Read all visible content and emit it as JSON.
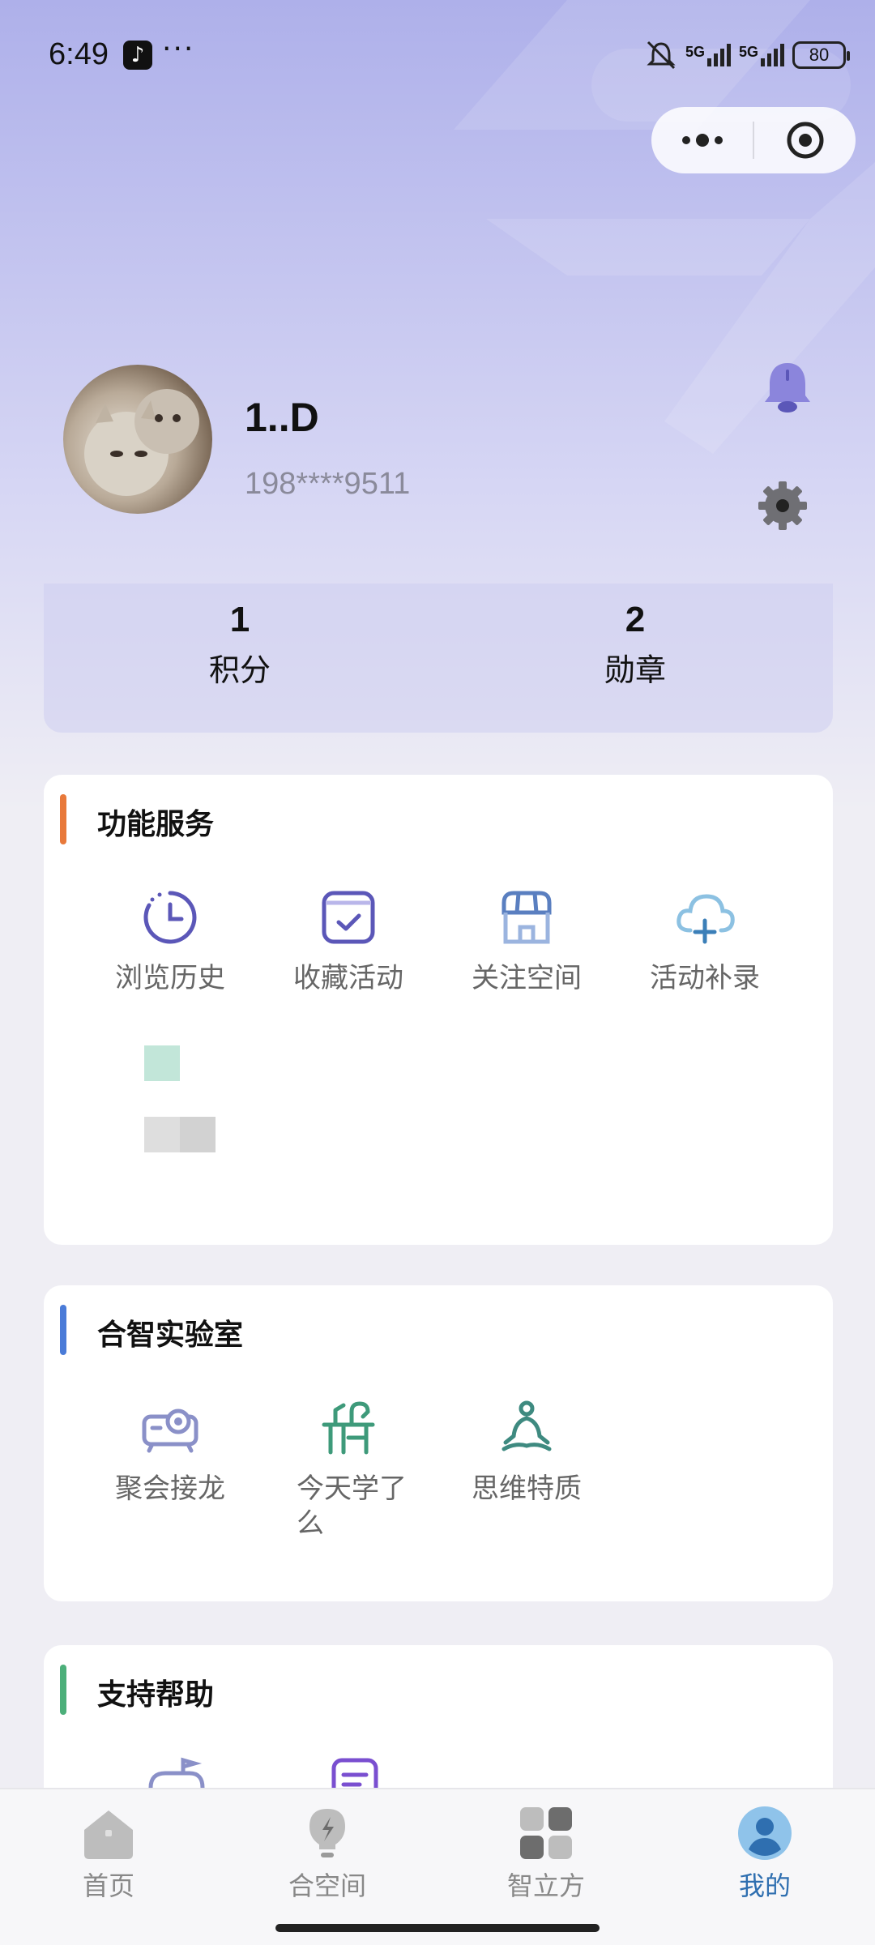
{
  "status_bar": {
    "time": "6:49",
    "dots": "···",
    "signal1": "5G",
    "signal2": "5G",
    "battery": "80"
  },
  "profile": {
    "name": "1..D",
    "phone": "198****9511"
  },
  "stats": [
    {
      "value": "1",
      "label": "积分"
    },
    {
      "value": "2",
      "label": "勋章"
    }
  ],
  "sections": {
    "services": {
      "title": "功能服务",
      "accent": "#e8793a",
      "items": [
        {
          "label": "浏览历史",
          "icon": "clock-icon"
        },
        {
          "label": "收藏活动",
          "icon": "calendar-check-icon"
        },
        {
          "label": "关注空间",
          "icon": "storefront-icon"
        },
        {
          "label": "活动补录",
          "icon": "cloud-plus-icon"
        }
      ]
    },
    "lab": {
      "title": "合智实验室",
      "accent": "#4a7bd8",
      "items": [
        {
          "label": "聚会接龙",
          "icon": "projector-icon"
        },
        {
          "label": "今天学了么",
          "icon": "study-desk-icon"
        },
        {
          "label": "思维特质",
          "icon": "meditation-icon"
        }
      ]
    },
    "help": {
      "title": "支持帮助",
      "accent": "#4caf7a"
    }
  },
  "tabbar": [
    {
      "label": "首页",
      "icon": "home-icon",
      "active": false
    },
    {
      "label": "合空间",
      "icon": "bulb-icon",
      "active": false
    },
    {
      "label": "智立方",
      "icon": "grid-icon",
      "active": false
    },
    {
      "label": "我的",
      "icon": "user-icon",
      "active": true
    }
  ],
  "colors": {
    "primary_purple": "#5b57b8",
    "tab_active": "#2f6fb0"
  }
}
